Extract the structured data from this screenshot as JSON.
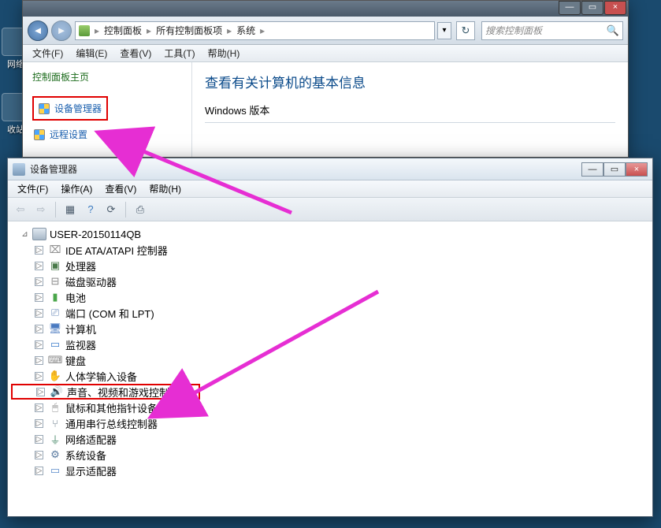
{
  "desktop": {
    "icon1_label": "网络",
    "icon2_label": "收站"
  },
  "win1": {
    "nav_back_glyph": "◄",
    "nav_fwd_glyph": "►",
    "breadcrumb": {
      "seg0": "▸",
      "seg1": "控制面板",
      "seg2": "所有控制面板项",
      "seg3": "系统",
      "sep": "▸"
    },
    "refresh_glyph": "↻",
    "search_placeholder": "搜索控制面板",
    "search_icon": "🔍",
    "menu": {
      "file": "文件(F)",
      "edit": "编辑(E)",
      "view": "查看(V)",
      "tools": "工具(T)",
      "help": "帮助(H)"
    },
    "sidebar_title": "控制面板主页",
    "link_device_mgr": "设备管理器",
    "link_remote": "远程设置",
    "main_heading": "查看有关计算机的基本信息",
    "windows_version_label": "Windows 版本"
  },
  "win2": {
    "title": "设备管理器",
    "wm_min": "—",
    "wm_max": "▭",
    "wm_close": "×",
    "menu": {
      "file": "文件(F)",
      "action": "操作(A)",
      "view": "查看(V)",
      "help": "帮助(H)"
    },
    "toolbar": {
      "back": "⇦",
      "fwd": "⇨",
      "props": "▦",
      "help": "?",
      "refresh": "⟳",
      "scan": "⎙"
    },
    "root_name": "USER-20150114QB",
    "items": [
      {
        "icon": "⌧",
        "cls": "ic-ide",
        "label": "IDE ATA/ATAPI 控制器"
      },
      {
        "icon": "▣",
        "cls": "ic-cpu",
        "label": "处理器"
      },
      {
        "icon": "⊟",
        "cls": "ic-disk",
        "label": "磁盘驱动器"
      },
      {
        "icon": "▮",
        "cls": "ic-batt",
        "label": "电池"
      },
      {
        "icon": "⎚",
        "cls": "ic-port",
        "label": "端口 (COM 和 LPT)"
      },
      {
        "icon": "🖥",
        "cls": "ic-comp",
        "label": "计算机"
      },
      {
        "icon": "▭",
        "cls": "ic-mon",
        "label": "监视器"
      },
      {
        "icon": "⌨",
        "cls": "ic-kb",
        "label": "键盘"
      },
      {
        "icon": "✋",
        "cls": "ic-hid",
        "label": "人体学输入设备"
      },
      {
        "icon": "🔊",
        "cls": "ic-sound",
        "label": "声音、视频和游戏控制器",
        "highlight": true
      },
      {
        "icon": "🖱",
        "cls": "ic-mouse",
        "label": "鼠标和其他指针设备"
      },
      {
        "icon": "⑂",
        "cls": "ic-usb",
        "label": "通用串行总线控制器"
      },
      {
        "icon": "⏚",
        "cls": "ic-net",
        "label": "网络适配器"
      },
      {
        "icon": "⚙",
        "cls": "ic-sys",
        "label": "系统设备"
      },
      {
        "icon": "▭",
        "cls": "ic-disp",
        "label": "显示适配器"
      }
    ],
    "expander_glyph": "▷",
    "root_expander": "⊿"
  }
}
